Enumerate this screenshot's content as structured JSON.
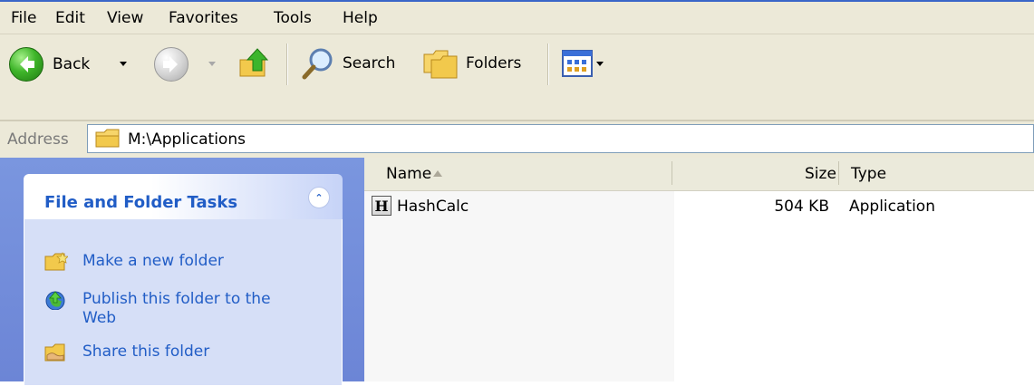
{
  "menu": [
    "File",
    "Edit",
    "View",
    "Favorites",
    "Tools",
    "Help"
  ],
  "toolbar": {
    "back_label": "Back",
    "search_label": "Search",
    "folders_label": "Folders"
  },
  "address": {
    "label": "Address",
    "path": "M:\\Applications"
  },
  "tasks": {
    "title": "File and Folder Tasks",
    "items": [
      {
        "label": "Make a new folder",
        "icon": "new-folder-icon"
      },
      {
        "label": "Publish this folder to the Web",
        "icon": "publish-web-icon"
      },
      {
        "label": "Share this folder",
        "icon": "share-folder-icon"
      }
    ]
  },
  "columns": {
    "name": "Name",
    "size": "Size",
    "type": "Type"
  },
  "files": [
    {
      "icon_letter": "H",
      "name": "HashCalc",
      "size": "504 KB",
      "type": "Application"
    }
  ],
  "colors": {
    "task_link": "#215dc6",
    "task_pane": "#6c85d6",
    "chrome": "#ece9d8"
  }
}
